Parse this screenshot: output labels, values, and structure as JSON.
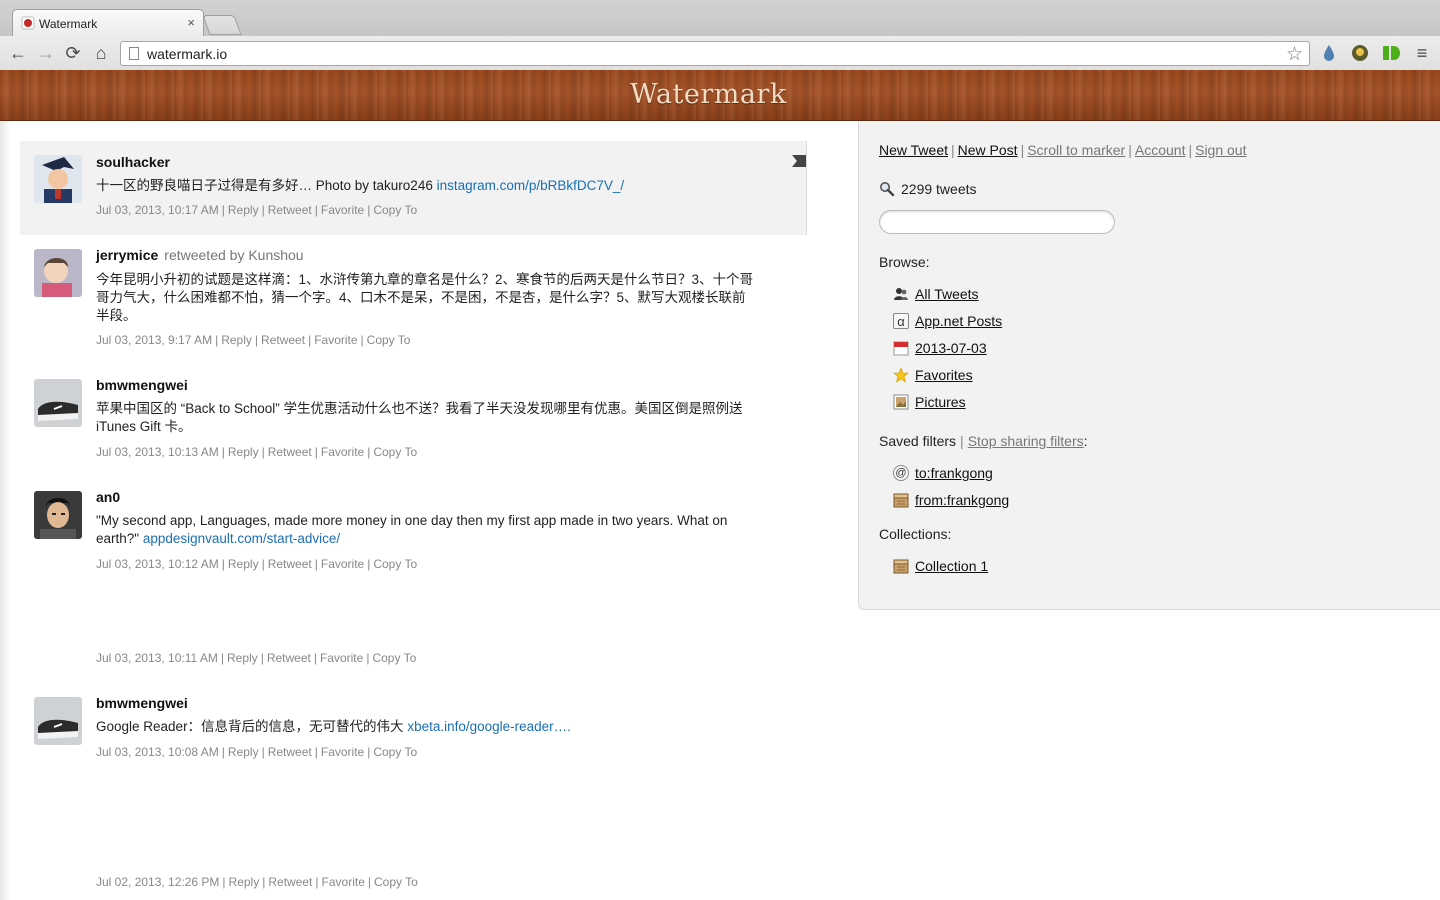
{
  "browser": {
    "tab_title": "Watermark",
    "tab_close": "×",
    "url": "watermark.io",
    "nav": {
      "back": "←",
      "forward": "→",
      "reload": "⟳",
      "home": "⌂"
    },
    "bookmark_icon": "star-icon",
    "menu_icon": "≡"
  },
  "app": {
    "logo": "Watermark"
  },
  "sidebar": {
    "links": {
      "new_tweet": "New Tweet",
      "new_post": "New Post",
      "scroll_to_marker": "Scroll to marker",
      "account": "Account",
      "sign_out": "Sign out",
      "separator": "|"
    },
    "tweet_count": "2299 tweets",
    "search_placeholder": "",
    "browse_label": "Browse:",
    "browse": [
      {
        "label": "All Tweets",
        "icon": "users-icon"
      },
      {
        "label": "App.net Posts",
        "icon": "alpha-icon"
      },
      {
        "label": "2013-07-03",
        "icon": "calendar-icon"
      },
      {
        "label": "Favorites",
        "icon": "star-icon"
      },
      {
        "label": "Pictures",
        "icon": "picture-icon"
      }
    ],
    "saved_filters_label": "Saved filters",
    "stop_sharing": "Stop sharing filters",
    "saved_filters": [
      {
        "label": "to:frankgong",
        "icon": "at-icon"
      },
      {
        "label": "from:frankgong",
        "icon": "box-icon"
      }
    ],
    "collections_label": "Collections:",
    "collections": [
      {
        "label": "Collection 1",
        "icon": "box-icon"
      }
    ]
  },
  "actions": {
    "reply": "Reply",
    "retweet": "Retweet",
    "favorite": "Favorite",
    "copy_to": "Copy To",
    "sep": "|"
  },
  "tweets": [
    {
      "user": "soulhacker",
      "text": "十一区的野良喵日子过得是有多好… Photo by takuro246 ",
      "link": "instagram.com/p/bRBkfDC7V_/",
      "time": "Jul 03, 2013, 10:17 AM"
    },
    {
      "user": "jerrymice",
      "retweeted_by": "retweeted by Kunshou",
      "text": "今年昆明小升初的试题是这样滴：1、水浒传第九章的章名是什么？2、寒食节的后两天是什么节日？3、十个哥哥力气大，什么困难都不怕，猜一个字。4、口木不是呆，不是困，不是杏，是什么字？5、默写大观楼长联前半段。",
      "time": "Jul 03, 2013, 9:17 AM"
    },
    {
      "user": "bmwmengwei",
      "text": "苹果中国区的 “Back to School” 学生优惠活动什么也不送？我看了半天没发现哪里有优惠。美国区倒是照例送 iTunes Gift 卡。",
      "time": "Jul 03, 2013, 10:13 AM"
    },
    {
      "user": "an0",
      "text": "\"My second app, Languages, made more money in one day then my first app made in two years. What on earth?\" ",
      "link": "appdesignvault.com/start-advice/",
      "time": "Jul 03, 2013, 10:12 AM"
    },
    {
      "time": "Jul 03, 2013, 10:11 AM"
    },
    {
      "user": "bmwmengwei",
      "text": "Google Reader：信息背后的信息，无可替代的伟大 ",
      "link": "xbeta.info/google-reader….",
      "time": "Jul 03, 2013, 10:08 AM"
    },
    {
      "time": "Jul 02, 2013, 12:26 PM"
    }
  ]
}
